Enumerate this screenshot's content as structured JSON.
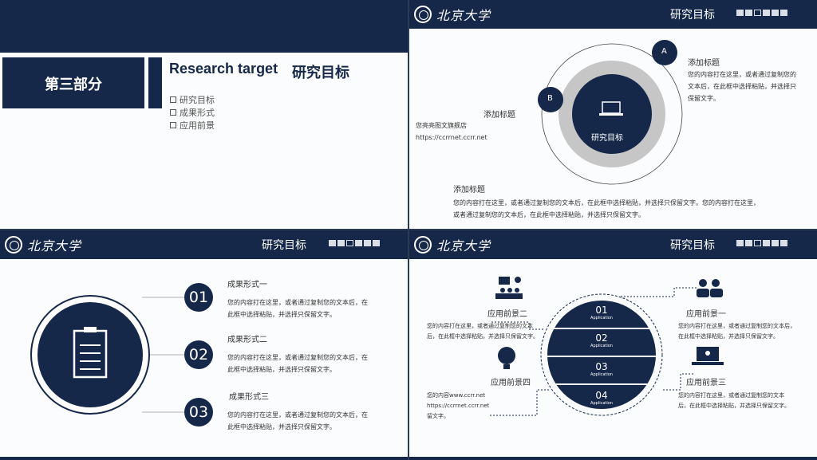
{
  "brand": {
    "logo_text": "北京大学"
  },
  "slide1": {
    "section": "第三部分",
    "title_en": "Research target",
    "title_cn": "研究目标",
    "bullets": [
      "研究目标",
      "成果形式",
      "应用前景"
    ]
  },
  "slide2": {
    "header_title": "研究目标",
    "center_label": "研究目标",
    "badge_a": "A",
    "badge_b": "B",
    "a_title": "添加标题",
    "a_text": [
      "您的内容打在这里，或者通过复制您的",
      "文本后，在此框中选择粘贴，并选择只",
      "保留文字。"
    ],
    "b_title": "添加标题",
    "b_text": [
      "您亮亮图文旗舰店",
      "https://ccrrnet.ccrr.net"
    ],
    "c_title": "添加标题",
    "c_text": [
      "您的内容打在这里，或者通过复制您的文本后，在此框中选择粘贴，并选择只保留文字。您的内容打在这里，",
      "或者通过复制您的文本后，在此框中选择粘贴，并选择只保留文字。"
    ]
  },
  "slide3": {
    "header_title": "研究目标",
    "items": [
      {
        "num": "01",
        "title": "成果形式一",
        "text": [
          "您的内容打在这里，或者通过复制您的文本后，在",
          "此框中选择粘贴，并选择只保留文字。"
        ]
      },
      {
        "num": "02",
        "title": "成果形式二",
        "text": [
          "您的内容打在这里，或者通过复制您的文本后，在",
          "此框中选择粘贴，并选择只保留文字。"
        ]
      },
      {
        "num": "03",
        "title": "成果形式三",
        "text": [
          "您的内容打在这里，或者通过复制您的文本后，在",
          "此框中选择粘贴，并选择只保留文字。"
        ]
      }
    ]
  },
  "slide4": {
    "header_title": "研究目标",
    "bands": [
      {
        "num": "01",
        "sub": "Application"
      },
      {
        "num": "02",
        "sub": "Application"
      },
      {
        "num": "03",
        "sub": "Application"
      },
      {
        "num": "04",
        "sub": "Application"
      }
    ],
    "p1": {
      "title": "应用前景一",
      "text": [
        "您的内容打在这里，或者通过复制您的文本后，",
        "在此框中选择粘贴，并选择只保留文字。"
      ]
    },
    "p2": {
      "title": "应用前景二",
      "text": [
        "您的内容打在这里，或者通过复制您的文本",
        "后，在此框中选择粘贴，并选择只保留文字。"
      ]
    },
    "p3": {
      "title": "应用前景三",
      "text": [
        "您的内容打在这里，或者通过复制您的文本",
        "后，在此框中选择粘贴，并选择只保留文字。"
      ]
    },
    "p4": {
      "title": "应用前景四",
      "text": [
        "您的内容www.ccrr.net",
        "https://ccrrnet.ccrr.net",
        "留文字。"
      ]
    }
  }
}
